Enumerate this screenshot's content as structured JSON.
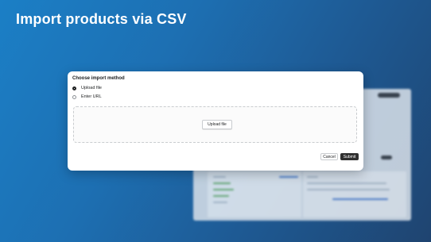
{
  "headline": "Import products via CSV",
  "dialog": {
    "title": "Choose import method",
    "options": [
      {
        "label": "Upload file",
        "selected": true
      },
      {
        "label": "Enter URL",
        "selected": false
      }
    ],
    "upload_button": "Upload file",
    "cancel_button": "Cancel",
    "submit_button": "Submit"
  },
  "colors": {
    "background_start": "#1b7fc6",
    "background_end": "#1f4470",
    "submit_button": "#303030"
  }
}
